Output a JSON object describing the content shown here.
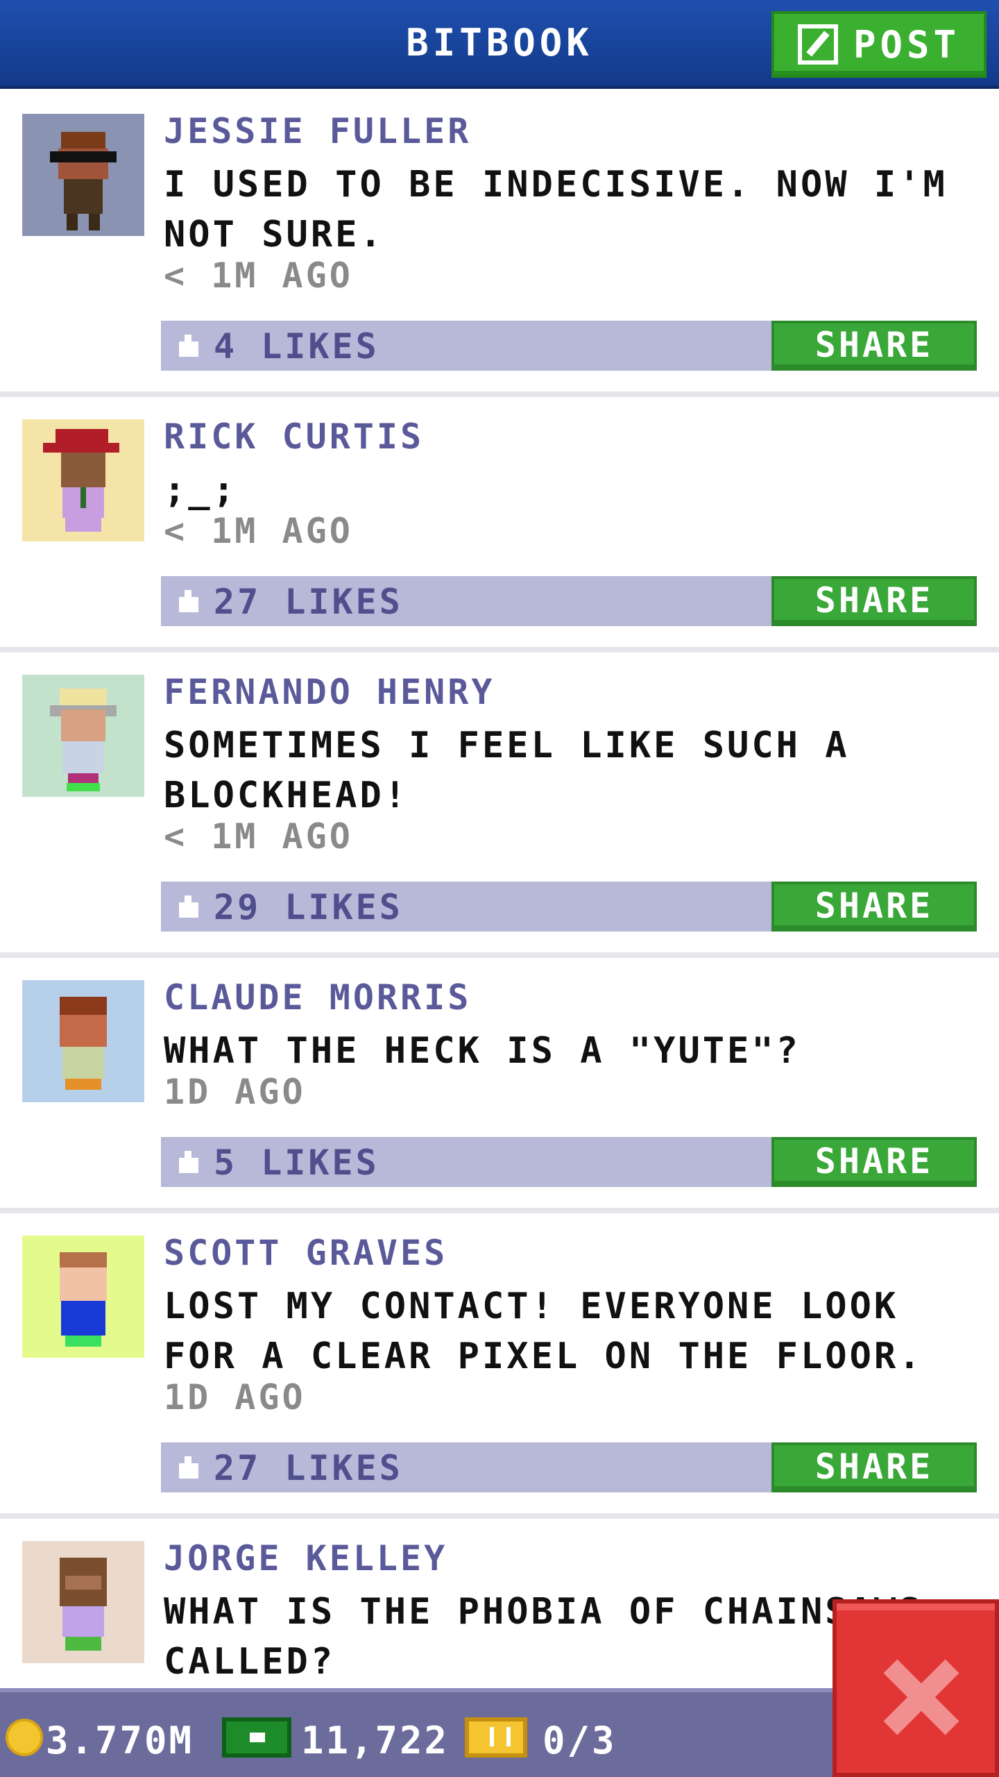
{
  "header": {
    "title": "BITBOOK",
    "post_label": "POST"
  },
  "share_label": "SHARE",
  "posts": [
    {
      "name": "JESSIE FULLER",
      "text": "I USED TO BE INDECISIVE. NOW I'M NOT SURE.",
      "time": "< 1M AGO",
      "likes": "4 LIKES",
      "avatar_bg": "#8a93b1"
    },
    {
      "name": "RICK CURTIS",
      "text": ";_;",
      "time": "< 1M AGO",
      "likes": "27 LIKES",
      "avatar_bg": "#f4e4a8"
    },
    {
      "name": "FERNANDO HENRY",
      "text": "SOMETIMES I FEEL LIKE SUCH A BLOCKHEAD!",
      "time": "< 1M AGO",
      "likes": "29 LIKES",
      "avatar_bg": "#c3e2cc"
    },
    {
      "name": "CLAUDE MORRIS",
      "text": "WHAT THE HECK IS A \"YUTE\"?",
      "time": "1D AGO",
      "likes": "5 LIKES",
      "avatar_bg": "#b7d0ea"
    },
    {
      "name": "SCOTT GRAVES",
      "text": "LOST MY CONTACT! EVERYONE LOOK FOR A CLEAR PIXEL ON THE FLOOR.",
      "time": "1D AGO",
      "likes": "27 LIKES",
      "avatar_bg": "#e5fa8d"
    },
    {
      "name": "JORGE KELLEY",
      "text": "WHAT IS THE PHOBIA OF CHAINSAWS CALLED?",
      "time": "",
      "likes": "",
      "avatar_bg": "#ebdacb"
    }
  ],
  "bottom": {
    "coins": "3.770M",
    "bux": "11,722",
    "tickets": "0/3"
  },
  "icons": {
    "post": "edit-icon",
    "like": "thumbs-up-icon",
    "coin": "coin-icon",
    "bux": "bux-icon",
    "ticket": "ticket-icon",
    "close": "close-icon"
  },
  "colors": {
    "header": "#1a47a3",
    "accent_green": "#3aa838",
    "likes_bar": "#b8b8d8",
    "name_purple": "#5a5a9a",
    "close_red": "#e23636"
  }
}
